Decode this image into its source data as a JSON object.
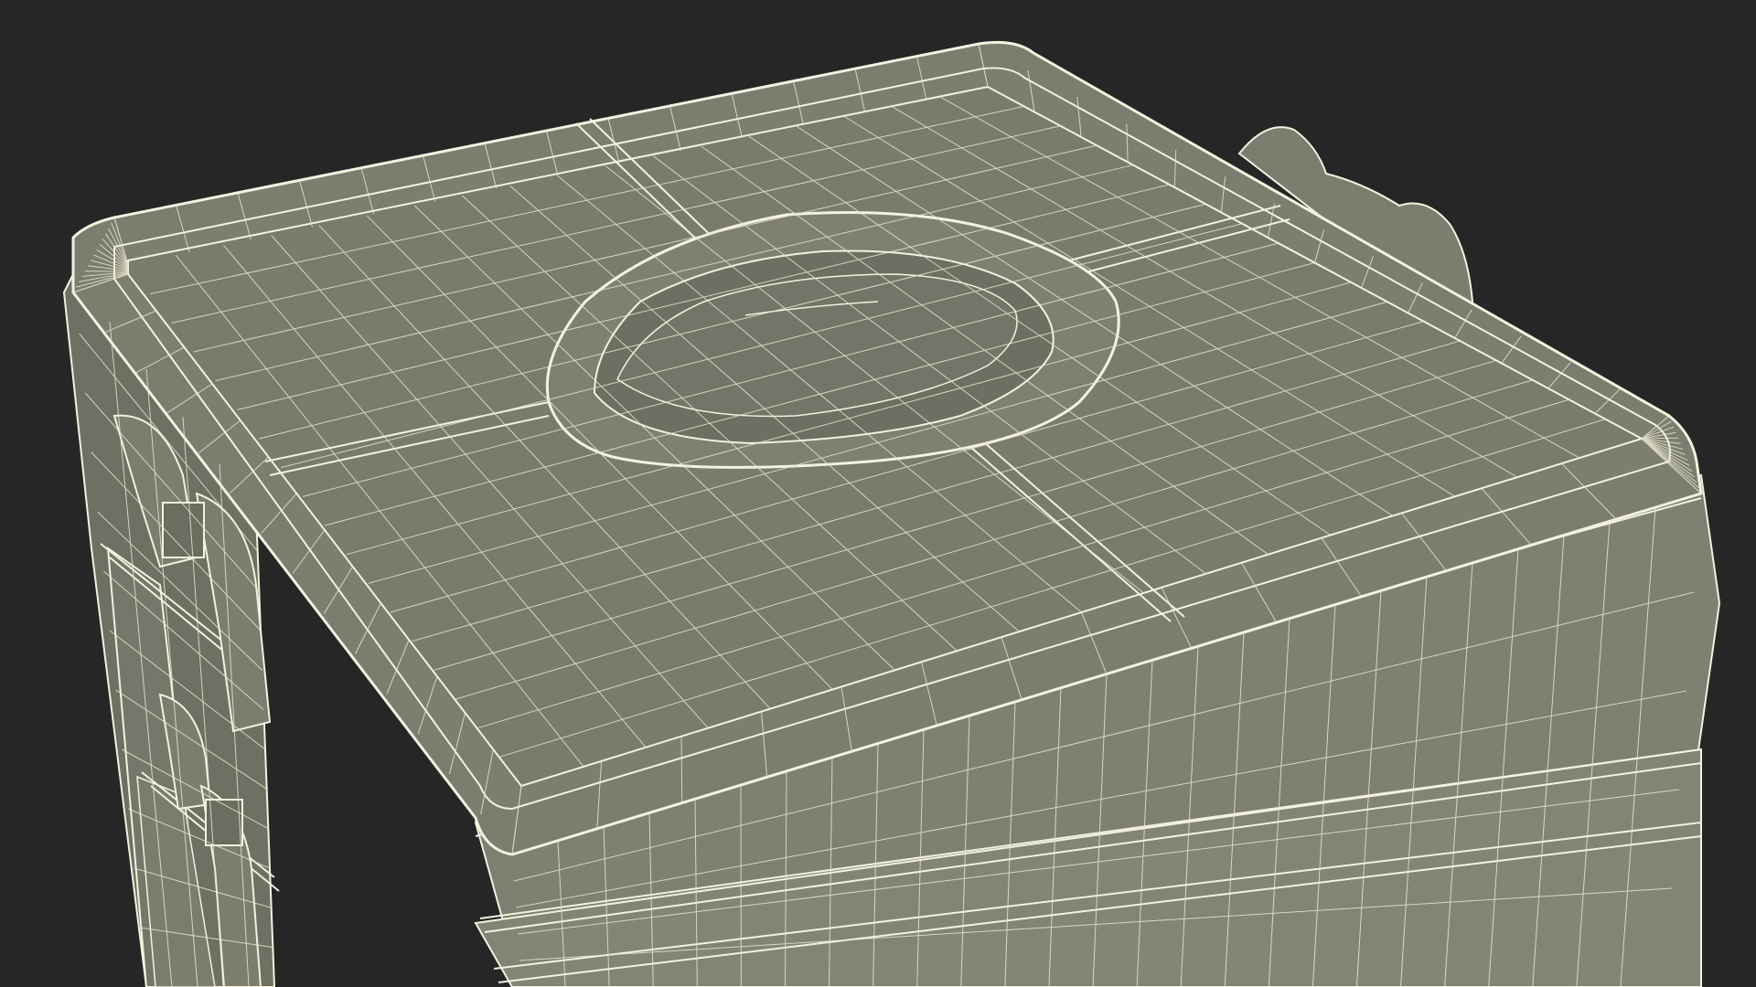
{
  "scene": {
    "subject": "wireframe-render",
    "colors": {
      "background": "#262626",
      "surface": "#7c7c6f",
      "surface_light": "#88887a",
      "surface_dark": "#6c6c60",
      "wire": "#e6e6cf",
      "edge": "#f2f2df"
    }
  }
}
